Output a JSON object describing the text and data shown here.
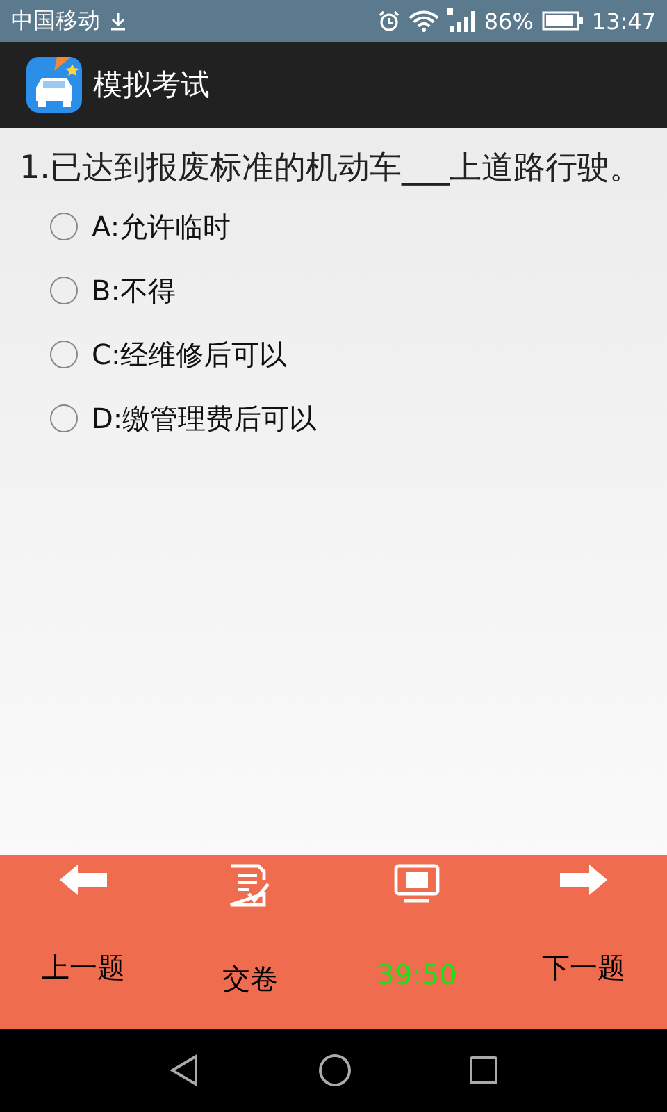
{
  "status_bar": {
    "carrier": "中国移动",
    "battery": "86%",
    "time": "13:47"
  },
  "app_bar": {
    "title": "模拟考试"
  },
  "question": {
    "text": "1.已达到报废标准的机动车___上道路行驶。",
    "options": [
      {
        "label": "A:允许临时",
        "selected": false
      },
      {
        "label": "B:不得",
        "selected": false
      },
      {
        "label": "C:经维修后可以",
        "selected": false
      },
      {
        "label": "D:缴管理费后可以",
        "selected": false
      }
    ]
  },
  "toolbar": [
    {
      "kind": "prev",
      "label": "上一题"
    },
    {
      "kind": "submit",
      "label": "交卷"
    },
    {
      "kind": "timer",
      "label": "39:50"
    },
    {
      "kind": "next",
      "label": "下一题"
    }
  ]
}
